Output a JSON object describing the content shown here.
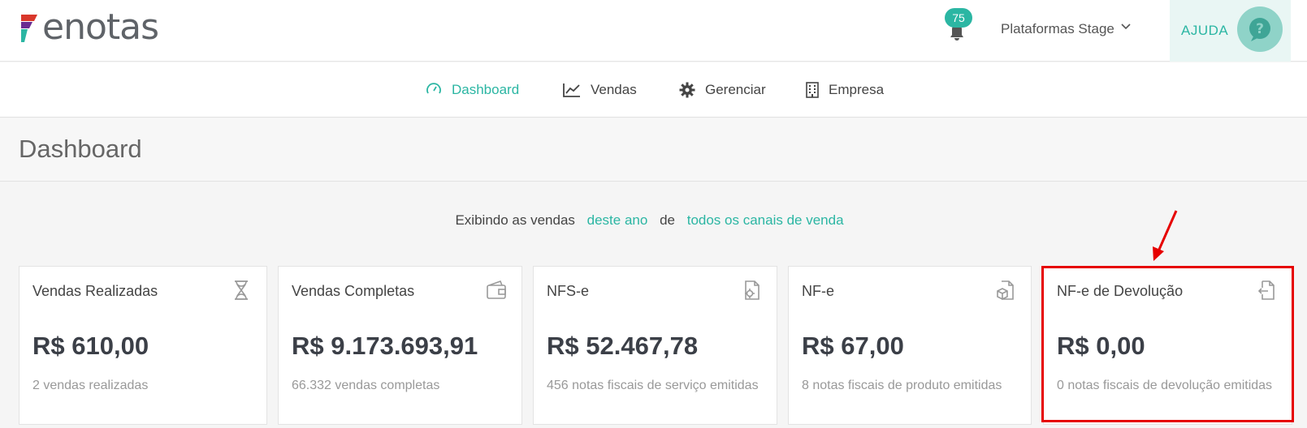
{
  "header": {
    "logo_text": "enotas",
    "notification_count": "75",
    "platform_label": "Plataformas Stage",
    "help_label": "AJUDA"
  },
  "nav": {
    "items": [
      {
        "label": "Dashboard",
        "icon": "gauge-icon",
        "active": true
      },
      {
        "label": "Vendas",
        "icon": "line-chart-icon"
      },
      {
        "label": "Gerenciar",
        "icon": "gear-icon"
      },
      {
        "label": "Empresa",
        "icon": "building-icon"
      }
    ]
  },
  "page": {
    "title": "Dashboard"
  },
  "filter": {
    "prefix": "Exibindo as vendas",
    "period": "deste ano",
    "connector": "de",
    "channels": "todos os canais de venda"
  },
  "cards": [
    {
      "title": "Vendas Realizadas",
      "value": "R$ 610,00",
      "subtitle": "2 vendas realizadas",
      "icon": "hourglass-icon"
    },
    {
      "title": "Vendas Completas",
      "value": "R$ 9.173.693,91",
      "subtitle": "66.332 vendas completas",
      "icon": "wallet-icon"
    },
    {
      "title": "NFS-e",
      "value": "R$ 52.467,78",
      "subtitle": "456 notas fiscais de serviço emitidas",
      "icon": "document-gear-icon"
    },
    {
      "title": "NF-e",
      "value": "R$ 67,00",
      "subtitle": "8 notas fiscais de produto emitidas",
      "icon": "document-box-icon"
    },
    {
      "title": "NF-e de Devolução",
      "value": "R$ 0,00",
      "subtitle": "0 notas fiscais de devolução emitidas",
      "icon": "document-return-icon"
    }
  ],
  "colors": {
    "accent": "#2bb6a3",
    "highlight": "#e60000"
  }
}
